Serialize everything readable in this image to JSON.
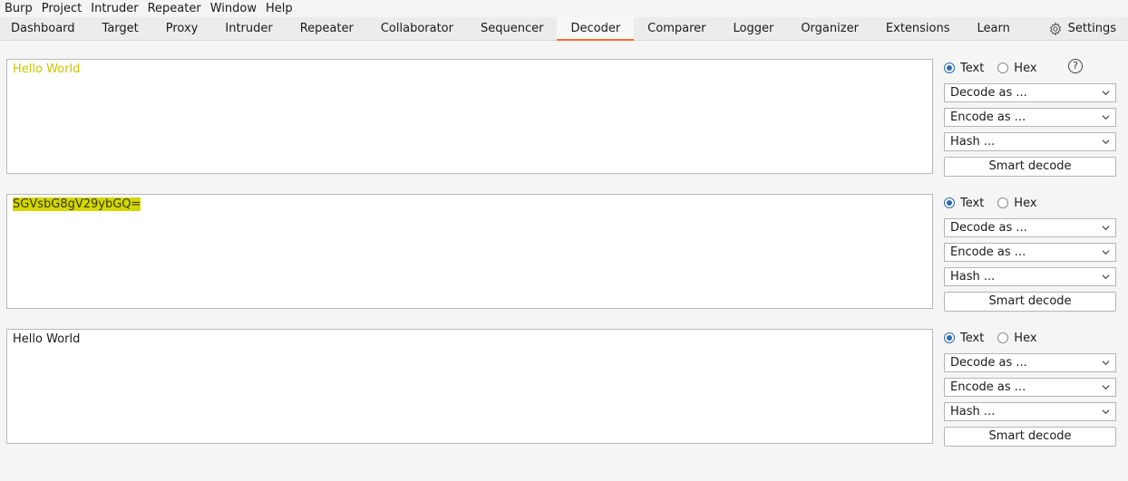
{
  "menubar": [
    "Burp",
    "Project",
    "Intruder",
    "Repeater",
    "Window",
    "Help"
  ],
  "tabs": [
    "Dashboard",
    "Target",
    "Proxy",
    "Intruder",
    "Repeater",
    "Collaborator",
    "Sequencer",
    "Decoder",
    "Comparer",
    "Logger",
    "Organizer",
    "Extensions",
    "Learn"
  ],
  "active_tab": "Decoder",
  "settings_label": "Settings",
  "accent_color": "#ff6633",
  "help_glyph": "?",
  "panels": [
    {
      "content": "Hello World",
      "style": "yellow-text",
      "mode_text": "Text",
      "mode_hex": "Hex",
      "selected_mode": "Text",
      "decode_label": "Decode as ...",
      "encode_label": "Encode as ...",
      "hash_label": "Hash ...",
      "smart_label": "Smart decode"
    },
    {
      "content": "SGVsbG8gV29ybGQ=",
      "style": "highlighted",
      "mode_text": "Text",
      "mode_hex": "Hex",
      "selected_mode": "Text",
      "decode_label": "Decode as ...",
      "encode_label": "Encode as ...",
      "hash_label": "Hash ...",
      "smart_label": "Smart decode"
    },
    {
      "content": "Hello World",
      "style": "plain",
      "mode_text": "Text",
      "mode_hex": "Hex",
      "selected_mode": "Text",
      "decode_label": "Decode as ...",
      "encode_label": "Encode as ...",
      "hash_label": "Hash ...",
      "smart_label": "Smart decode"
    }
  ]
}
